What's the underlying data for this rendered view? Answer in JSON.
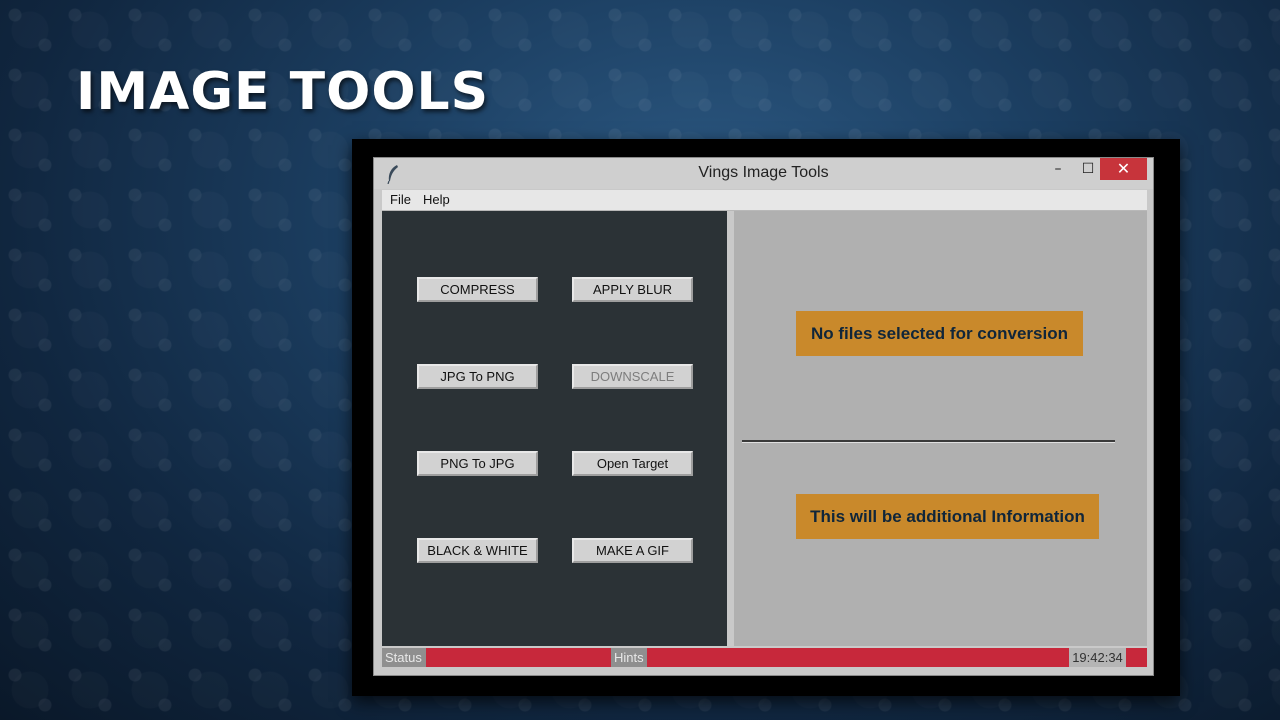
{
  "slide": {
    "title": "IMAGE TOOLS"
  },
  "window": {
    "title": "Vings Image Tools",
    "controls": {
      "minimize": "–",
      "maximize": "☐",
      "close": "✕"
    }
  },
  "menu": {
    "file": "File",
    "help": "Help"
  },
  "buttons": {
    "compress": "COMPRESS",
    "apply_blur": "APPLY BLUR",
    "jpg_to_png": "JPG To PNG",
    "downscale": "DOWNSCALE",
    "png_to_jpg": "PNG To JPG",
    "open_target": "Open Target",
    "black_white": "BLACK & WHITE",
    "make_gif": "MAKE A GIF"
  },
  "info": {
    "primary": "No files selected for conversion",
    "secondary": "This will be additional Information"
  },
  "statusbar": {
    "status_label": "Status",
    "hints_label": "Hints",
    "time": "19:42:34"
  },
  "icons": {
    "app": "feather-icon"
  },
  "colors": {
    "accent_orange": "#c9892b",
    "status_red": "#c7283b",
    "close_red": "#c7343b",
    "left_panel": "#2b3236"
  }
}
